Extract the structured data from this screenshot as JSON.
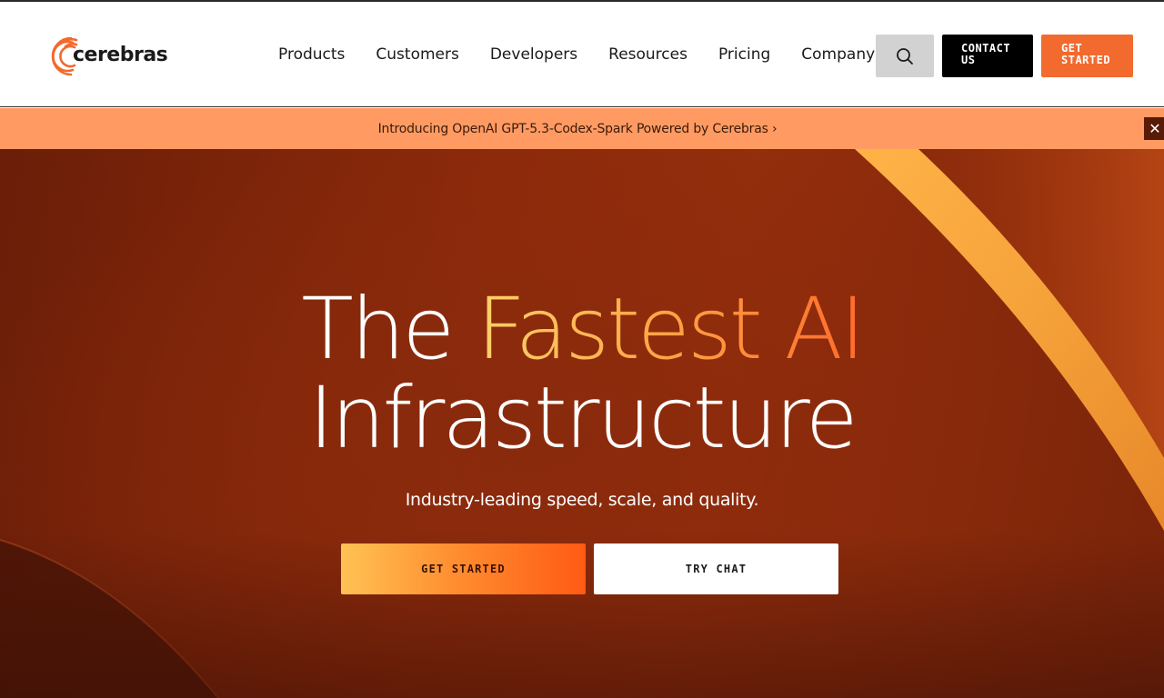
{
  "brand": {
    "name": "cerebras",
    "logo_icon": "cerebras-arc-logo",
    "accent_color": "#f26a2e"
  },
  "nav": {
    "items": [
      {
        "label": "Products"
      },
      {
        "label": "Customers"
      },
      {
        "label": "Developers"
      },
      {
        "label": "Resources"
      },
      {
        "label": "Pricing"
      },
      {
        "label": "Company"
      }
    ],
    "search_icon": "search-icon",
    "contact_label_line1": "CONTACT",
    "contact_label_line2": "US",
    "get_started_line1": "GET",
    "get_started_line2": "STARTED"
  },
  "announcement": {
    "text": "Introducing OpenAI GPT-5.3-Codex-Spark Powered by Cerebras",
    "arrow": "›",
    "close_icon": "close-icon",
    "close_glyph": "✕",
    "background": "#ff9b62"
  },
  "hero": {
    "title_part1": "The ",
    "title_accent": "Fastest AI",
    "title_line2": "Infrastructure",
    "subtitle": "Industry-leading speed, scale, and quality.",
    "primary_cta": "GET STARTED",
    "secondary_cta": "TRY CHAT"
  }
}
